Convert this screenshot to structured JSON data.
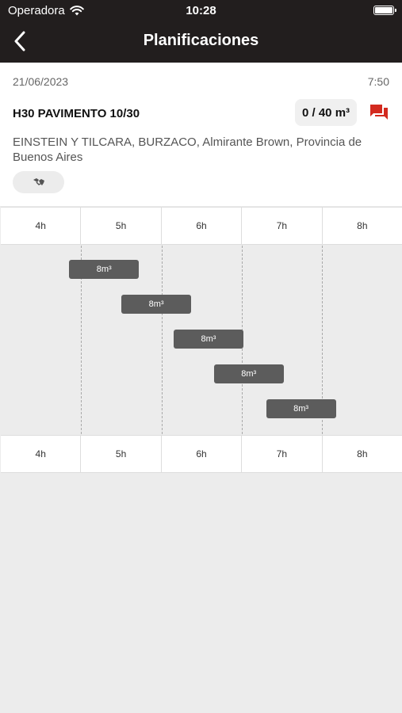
{
  "status_bar": {
    "carrier": "Operadora",
    "time": "10:28"
  },
  "nav": {
    "title": "Planificaciones",
    "back_icon": "chevron-left-icon"
  },
  "card": {
    "date": "21/06/2023",
    "hour": "7:50",
    "product": "H30 PAVIMENTO 10/30",
    "volume": "0 / 40 m³",
    "address": "EINSTEIN Y TILCARA, BURZACO, Almirante Brown, Provincia de Buenos Aires",
    "chat_icon": "chat-icon",
    "tag_icon": "handshake-icon",
    "accent_color": "#d32a1f"
  },
  "timeline": {
    "hours": [
      "4h",
      "5h",
      "6h",
      "7h",
      "8h"
    ],
    "loads": [
      {
        "label": "8m³",
        "start_hour": 4.85
      },
      {
        "label": "8m³",
        "start_hour": 5.5
      },
      {
        "label": "8m³",
        "start_hour": 6.15
      },
      {
        "label": "8m³",
        "start_hour": 6.65
      },
      {
        "label": "8m³",
        "start_hour": 7.3
      }
    ]
  }
}
